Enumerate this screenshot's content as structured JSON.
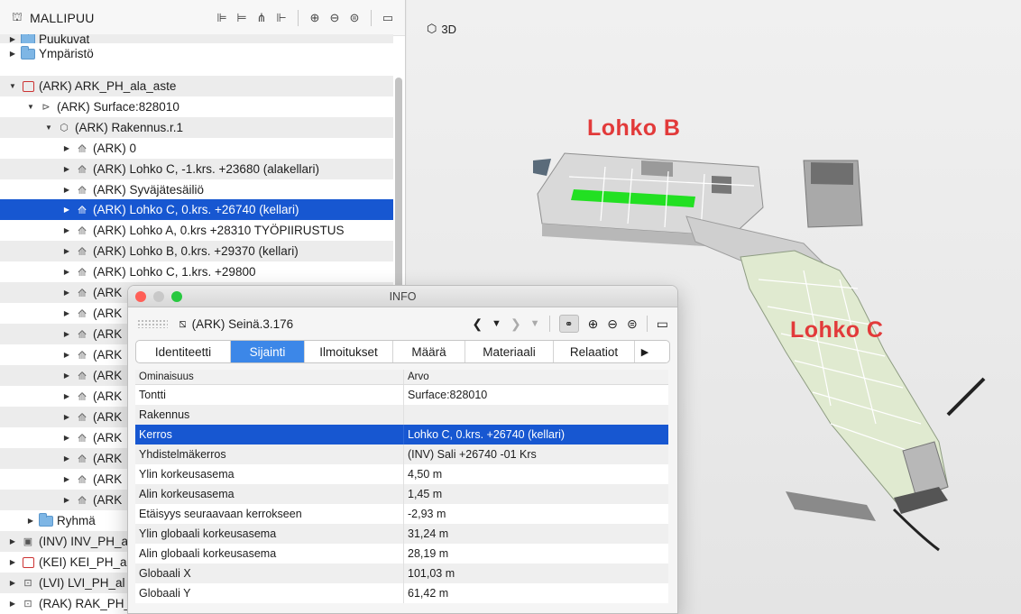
{
  "tree": {
    "title": "MALLIPUU",
    "rows": [
      {
        "label": "Puukuvat"
      },
      {
        "label": "Ympäristö"
      },
      {
        "label": "(ARK) ARK_PH_ala_aste"
      },
      {
        "label": "(ARK) Surface:828010"
      },
      {
        "label": "(ARK) Rakennus.r.1"
      },
      {
        "label": "(ARK) 0"
      },
      {
        "label": "(ARK) Lohko C, -1.krs. +23680 (alakellari)"
      },
      {
        "label": "(ARK) Syväjätesäiliö"
      },
      {
        "label": "(ARK) Lohko C, 0.krs. +26740 (kellari)"
      },
      {
        "label": "(ARK) Lohko A, 0.krs +28310 TYÖPIIRUSTUS"
      },
      {
        "label": "(ARK) Lohko B, 0.krs. +29370 (kellari)"
      },
      {
        "label": "(ARK) Lohko C, 1.krs. +29800"
      },
      {
        "label": "(ARK"
      },
      {
        "label": "(ARK"
      },
      {
        "label": "(ARK"
      },
      {
        "label": "(ARK"
      },
      {
        "label": "(ARK"
      },
      {
        "label": "(ARK"
      },
      {
        "label": "(ARK"
      },
      {
        "label": "(ARK"
      },
      {
        "label": "(ARK"
      },
      {
        "label": "(ARK"
      },
      {
        "label": "(ARK"
      },
      {
        "label": "Ryhmä"
      },
      {
        "label": "(INV) INV_PH_a"
      },
      {
        "label": "(KEI) KEI_PH_al"
      },
      {
        "label": "(LVI) LVI_PH_al"
      },
      {
        "label": "(RAK) RAK_PH_"
      }
    ]
  },
  "view3d": {
    "label": "3D",
    "labels": {
      "b": "Lohko B",
      "c": "Lohko C"
    }
  },
  "info": {
    "window_title": "INFO",
    "object_name": "(ARK) Seinä.3.176",
    "tabs": [
      {
        "label": "Identiteetti"
      },
      {
        "label": "Sijainti"
      },
      {
        "label": "Ilmoitukset"
      },
      {
        "label": "Määrä"
      },
      {
        "label": "Materiaali"
      },
      {
        "label": "Relaatiot"
      }
    ],
    "active_tab": "Sijainti",
    "columns": {
      "key": "Ominaisuus",
      "value": "Arvo"
    },
    "rows": [
      {
        "key": "Tontti",
        "value": "Surface:828010"
      },
      {
        "key": "Rakennus",
        "value": ""
      },
      {
        "key": "Kerros",
        "value": "Lohko C, 0.krs. +26740 (kellari)"
      },
      {
        "key": "Yhdistelmäkerros",
        "value": "(INV) Sali +26740 -01 Krs"
      },
      {
        "key": "Ylin korkeusasema",
        "value": "4,50 m"
      },
      {
        "key": "Alin korkeusasema",
        "value": "1,45 m"
      },
      {
        "key": "Etäisyys seuraavaan kerrokseen",
        "value": "-2,93 m"
      },
      {
        "key": "Ylin globaali korkeusasema",
        "value": "31,24 m"
      },
      {
        "key": "Alin globaali korkeusasema",
        "value": "28,19 m"
      },
      {
        "key": "Globaali X",
        "value": "101,03 m"
      },
      {
        "key": "Globaali Y",
        "value": "61,42 m"
      }
    ]
  },
  "colors": {
    "selection": "#1757d1",
    "active_tab": "#3c87e8",
    "label_red": "#e23a3a",
    "highlight_green": "#22e022"
  }
}
